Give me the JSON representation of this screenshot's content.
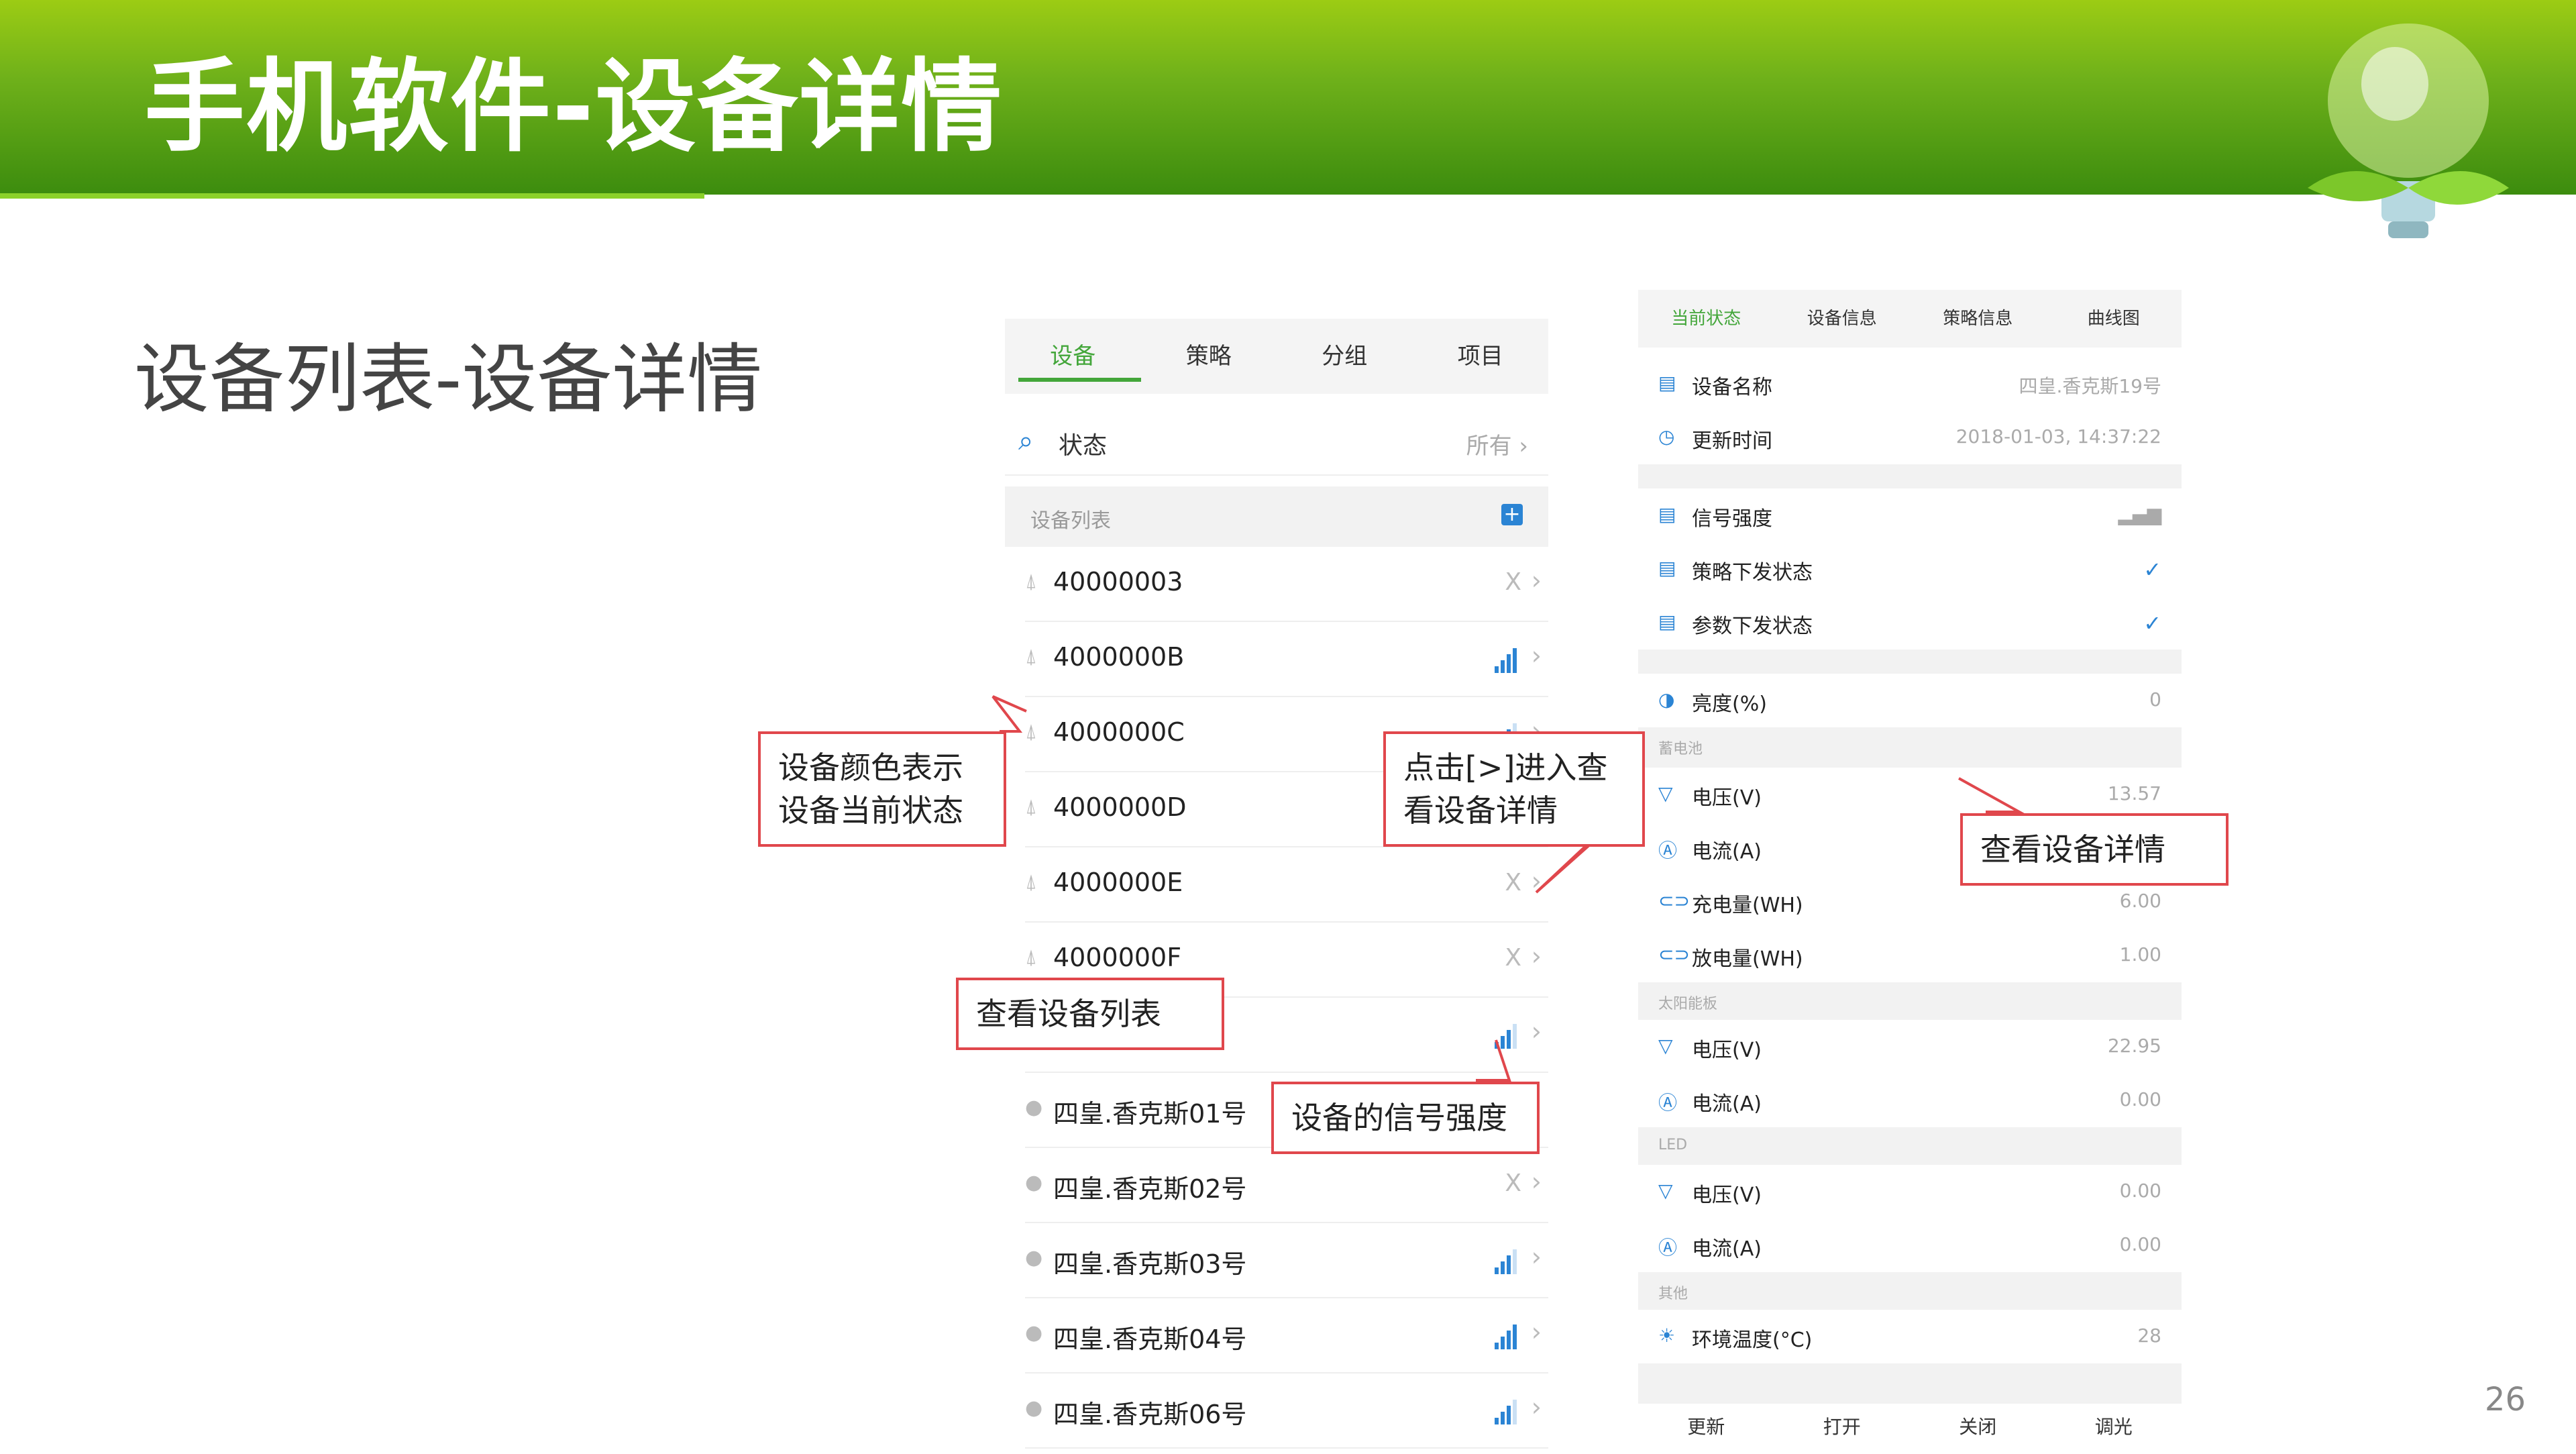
{
  "header": {
    "title": "手机软件-设备详情"
  },
  "subtitle": "设备列表-设备详情",
  "page_number": "26",
  "phone_list": {
    "tabs": [
      {
        "label": "设备",
        "active": true
      },
      {
        "label": "策略",
        "active": false
      },
      {
        "label": "分组",
        "active": false
      },
      {
        "label": "项目",
        "active": false
      }
    ],
    "filter": {
      "label": "状态",
      "value": "所有 ›"
    },
    "section": {
      "label": "设备列表",
      "add": "+"
    },
    "devices": [
      {
        "name": "40000003",
        "status": "X",
        "signal": null
      },
      {
        "name": "4000000B",
        "status": "",
        "signal": 4
      },
      {
        "name": "4000000C",
        "status": "",
        "signal": 3
      },
      {
        "name": "4000000D",
        "status": "",
        "signal": null
      },
      {
        "name": "4000000E",
        "status": "X",
        "signal": null
      },
      {
        "name": "4000000F",
        "status": "X",
        "signal": null
      },
      {
        "name": "",
        "status": "",
        "signal": 3
      },
      {
        "name": "四皇.香克斯01号",
        "status": "",
        "signal": null
      },
      {
        "name": "四皇.香克斯02号",
        "status": "X",
        "signal": null
      },
      {
        "name": "四皇.香克斯03号",
        "status": "",
        "signal": 3
      },
      {
        "name": "四皇.香克斯04号",
        "status": "",
        "signal": 4
      },
      {
        "name": "四皇.香克斯06号",
        "status": "",
        "signal": 3
      }
    ]
  },
  "phone_detail": {
    "tabs": [
      {
        "label": "当前状态",
        "active": true
      },
      {
        "label": "设备信息",
        "active": false
      },
      {
        "label": "策略信息",
        "active": false
      },
      {
        "label": "曲线图",
        "active": false
      }
    ],
    "rows_a": [
      {
        "icon": "▤",
        "label": "设备名称",
        "value": "四皇.香克斯19号"
      },
      {
        "icon": "◷",
        "label": "更新时间",
        "value": "2018-01-03, 14:37:22"
      }
    ],
    "rows_b": [
      {
        "icon": "▤",
        "label": "信号强度",
        "value": "▂▄▆"
      },
      {
        "icon": "▤",
        "label": "策略下发状态",
        "value": "✓"
      },
      {
        "icon": "▤",
        "label": "参数下发状态",
        "value": "✓"
      }
    ],
    "brightness": {
      "icon": "◑",
      "label": "亮度(%)",
      "value": "0"
    },
    "battery": {
      "group": "蓄电池",
      "rows": [
        {
          "icon": "▽",
          "label": "电压(V)",
          "value": "13.57"
        },
        {
          "icon": "Ⓐ",
          "label": "电流(A)",
          "value": ""
        },
        {
          "icon": "⊂⊃",
          "label": "充电量(WH)",
          "value": "6.00"
        },
        {
          "icon": "⊂⊃",
          "label": "放电量(WH)",
          "value": "1.00"
        }
      ]
    },
    "solar": {
      "group": "太阳能板",
      "rows": [
        {
          "icon": "▽",
          "label": "电压(V)",
          "value": "22.95"
        },
        {
          "icon": "Ⓐ",
          "label": "电流(A)",
          "value": "0.00"
        }
      ]
    },
    "led": {
      "group": "LED",
      "rows": [
        {
          "icon": "▽",
          "label": "电压(V)",
          "value": "0.00"
        },
        {
          "icon": "Ⓐ",
          "label": "电流(A)",
          "value": "0.00"
        }
      ]
    },
    "other": {
      "group": "其他",
      "rows": [
        {
          "icon": "☀",
          "label": "环境温度(°C)",
          "value": "28"
        }
      ]
    },
    "bottom": [
      "更新",
      "打开",
      "关闭",
      "调光"
    ]
  },
  "callouts": {
    "color_state": "设备颜色表示设备当前状态",
    "click_enter": "点击[>]进入查看设备详情",
    "view_list": "查看设备列表",
    "signal": "设备的信号强度",
    "view_detail": "查看设备详情"
  }
}
